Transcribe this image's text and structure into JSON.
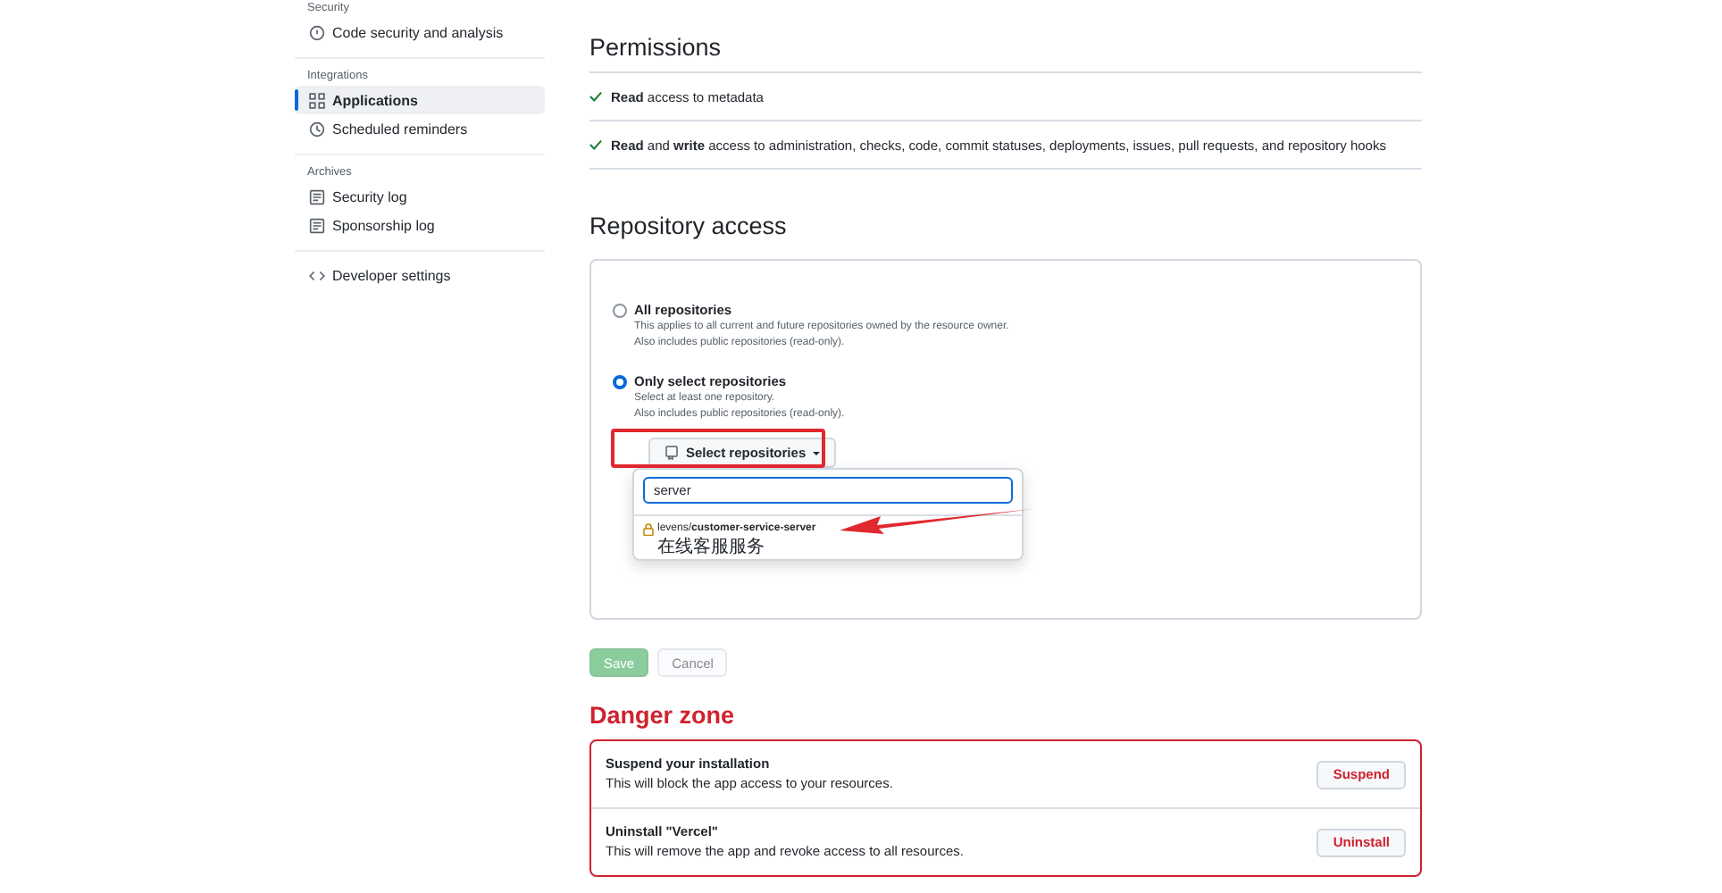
{
  "sidebar": {
    "sections": [
      {
        "heading": "Security",
        "items": [
          {
            "label": "Code security and analysis",
            "kind": "shield",
            "selected": false
          }
        ]
      },
      {
        "heading": "Integrations",
        "items": [
          {
            "label": "Applications",
            "kind": "apps",
            "selected": true
          },
          {
            "label": "Scheduled reminders",
            "kind": "clock",
            "selected": false
          }
        ]
      },
      {
        "heading": "Archives",
        "items": [
          {
            "label": "Security log",
            "kind": "log",
            "selected": false
          },
          {
            "label": "Sponsorship log",
            "kind": "log",
            "selected": false
          }
        ]
      },
      {
        "items": [
          {
            "label": "Developer settings",
            "kind": "code",
            "selected": false
          }
        ]
      }
    ]
  },
  "permissions": {
    "title": "Permissions",
    "items": [
      "**Read** access to metadata",
      "**Read** and **write** access to administration, checks, code, commit statuses, deployments, issues, pull requests, and repository hooks"
    ]
  },
  "repository_access": {
    "title": "Repository access",
    "options": [
      {
        "label": "All repositories",
        "description": [
          "This applies to all current and future repositories owned by the resource owner.",
          "Also includes public repositories (read-only)."
        ],
        "selected": false
      },
      {
        "label": "Only select repositories",
        "description": [
          "Select at least one repository.",
          "Also includes public repositories (read-only)."
        ],
        "selected": true
      }
    ],
    "select_button": "Select repositories",
    "dropdown": {
      "search_value": "server",
      "results": [
        {
          "name": "levens/**customer-service-server**",
          "description": "在线客服服务"
        }
      ]
    },
    "buttons": [
      {
        "label": "Save",
        "kind": "primary",
        "disabled": true
      },
      {
        "label": "Cancel",
        "kind": "secondary",
        "disabled": true
      }
    ]
  },
  "danger_zone": {
    "title": "Danger zone",
    "items": [
      {
        "title": "Suspend your installation",
        "description": "This will block the app access to your resources.",
        "button": "Suspend"
      },
      {
        "title": "Uninstall \"Vercel\"",
        "description": "This will remove the app and revoke access to all resources.",
        "button": "Uninstall"
      }
    ]
  }
}
